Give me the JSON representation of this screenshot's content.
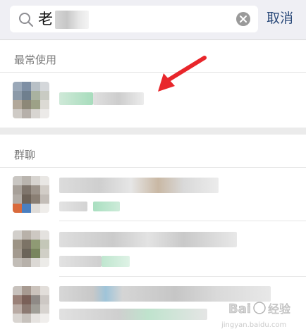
{
  "search": {
    "query": "老",
    "cancel_label": "取消"
  },
  "sections": {
    "frequent": {
      "title": "最常使用"
    },
    "groups": {
      "title": "群聊"
    }
  },
  "watermark": {
    "site": "Baidu 经验",
    "url": "jingyan.baidu.com"
  },
  "colors": {
    "accent": "#2b4a7a",
    "annotation_arrow": "#e8262b"
  }
}
